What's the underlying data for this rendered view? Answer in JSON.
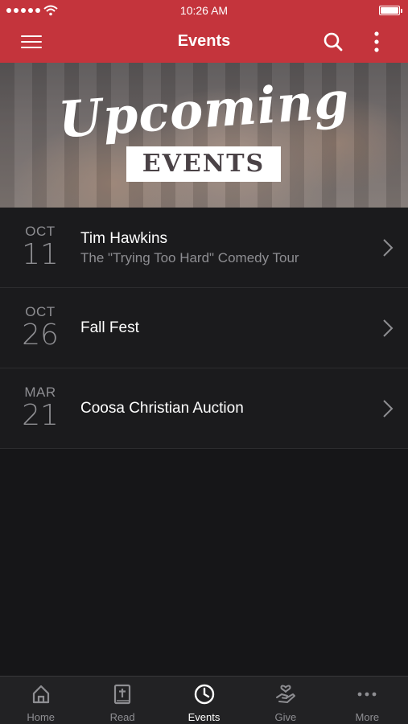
{
  "status_bar": {
    "time": "10:26 AM"
  },
  "nav": {
    "title": "Events"
  },
  "banner": {
    "script_text": "Upcoming",
    "box_text": "EVENTS"
  },
  "events": [
    {
      "month": "OCT",
      "day": "11",
      "title": "Tim Hawkins",
      "subtitle": "The \"Trying Too Hard\" Comedy Tour"
    },
    {
      "month": "OCT",
      "day": "26",
      "title": "Fall Fest",
      "subtitle": ""
    },
    {
      "month": "MAR",
      "day": "21",
      "title": "Coosa Christian Auction",
      "subtitle": ""
    }
  ],
  "tabs": [
    {
      "label": "Home",
      "icon": "home-icon"
    },
    {
      "label": "Read",
      "icon": "bible-icon"
    },
    {
      "label": "Events",
      "icon": "clock-icon",
      "active": true
    },
    {
      "label": "Give",
      "icon": "give-icon"
    },
    {
      "label": "More",
      "icon": "more-dots-icon"
    }
  ],
  "colors": {
    "header": "#c4343c",
    "background": "#161618",
    "tab_active": "#ffffff",
    "tab_inactive": "#8e8e92"
  }
}
